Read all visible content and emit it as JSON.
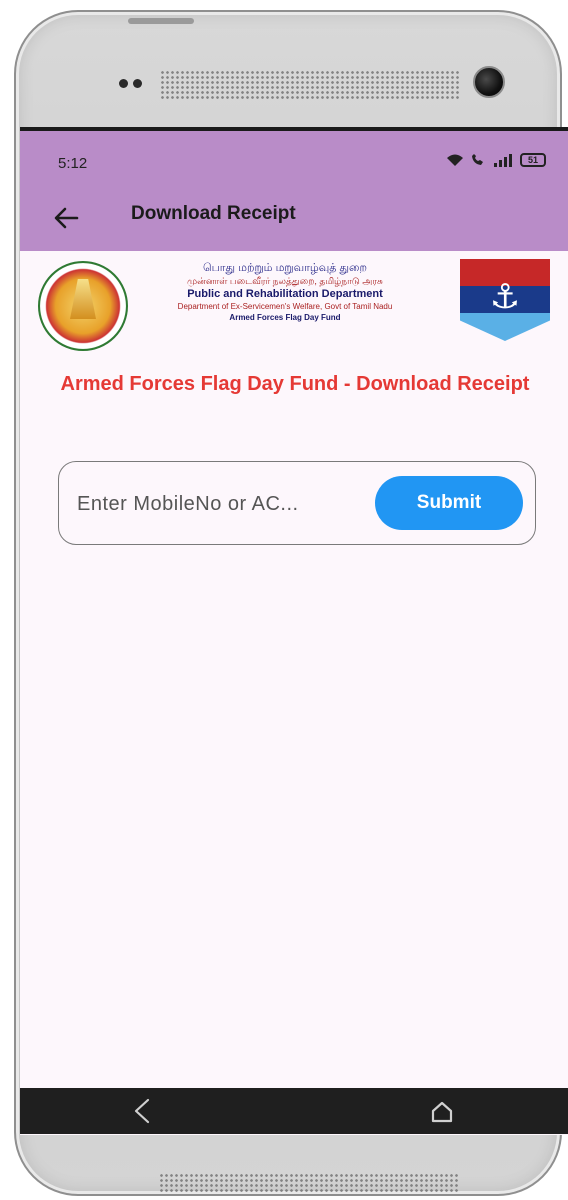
{
  "status_bar": {
    "time": "5:12",
    "battery": "51"
  },
  "app_bar": {
    "title": "Download Receipt",
    "back_icon": "arrow-left-icon"
  },
  "banner": {
    "tamil_line1": "பொது மற்றும் மறுவாழ்வுத் துறை",
    "tamil_line2": "முன்னாள் படைவீரர் நலத்துறை, தமிழ்நாடு அரசு",
    "department": "Public and Rehabilitation Department",
    "sub_department": "Department of Ex-Servicemen's Welfare, Govt of Tamil Nadu",
    "fund_name": "Armed Forces Flag Day Fund"
  },
  "page_heading": "Armed Forces Flag Day Fund - Download Receipt",
  "search": {
    "placeholder": "Enter MobileNo or AC...",
    "value": "",
    "submit_label": "Submit"
  },
  "colors": {
    "app_bar": "#b98cc8",
    "heading": "#e53935",
    "submit": "#2196f3",
    "background": "#fdf7fc"
  },
  "nav": {
    "back_icon": "nav-back-icon",
    "home_icon": "nav-home-icon"
  }
}
